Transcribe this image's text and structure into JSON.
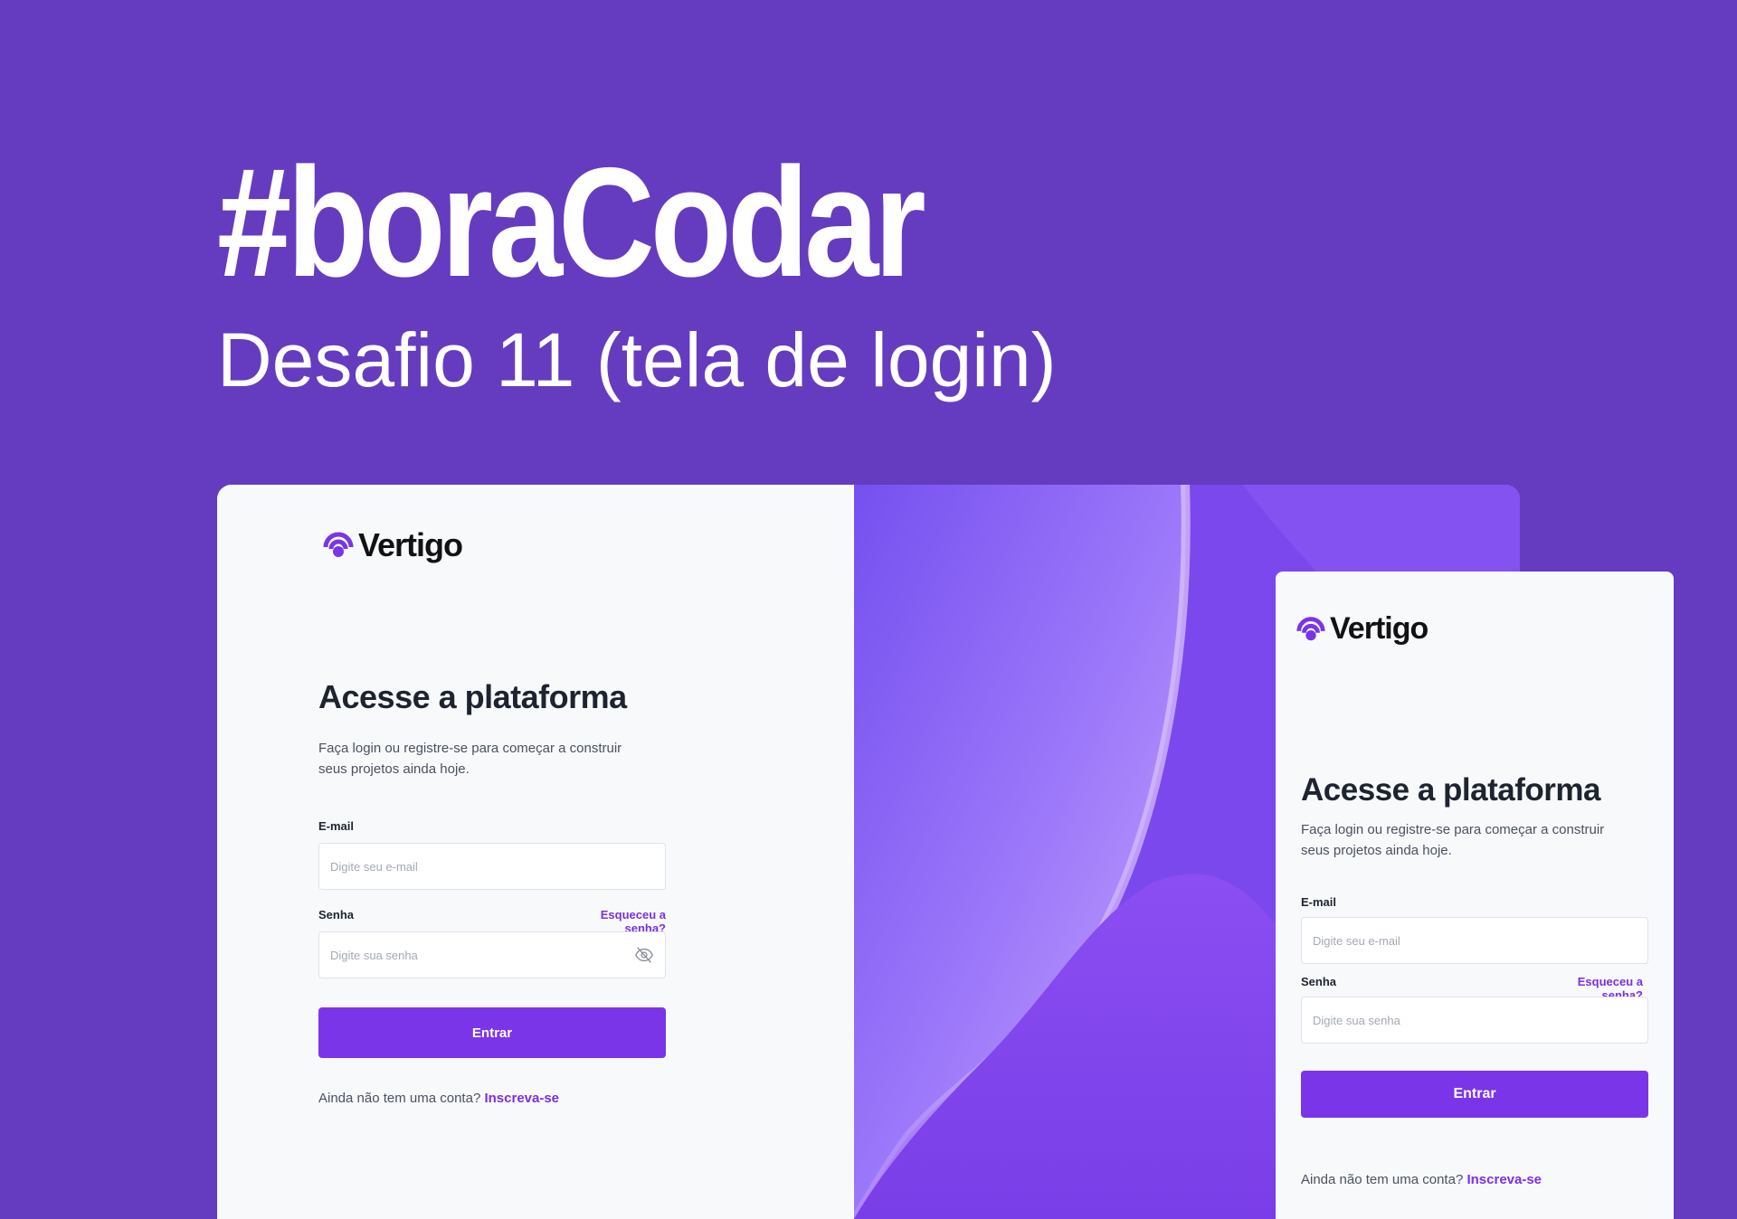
{
  "hero": {
    "title": "#boraCodar",
    "subtitle": "Desafio 11 (tela de login)"
  },
  "brand": {
    "name": "Vertigo",
    "logo_icon": "vertigo-logo-icon",
    "accent": "#7b35e8"
  },
  "form": {
    "title": "Acesse a plataforma",
    "description_line1": "Faça login ou registre-se para começar a construir",
    "description_line2": "seus projetos ainda hoje.",
    "email_label": "E-mail",
    "email_placeholder": "Digite seu e-mail",
    "password_label": "Senha",
    "forgot_label": "Esqueceu a senha?",
    "password_placeholder": "Digite sua senha",
    "password_toggle_icon": "eye-off-icon",
    "submit_label": "Entrar",
    "signup_prefix": "Ainda não tem uma conta?",
    "signup_link": "Inscreva-se"
  },
  "colors": {
    "page_bg": "#653cbf",
    "panel_gradient_start": "#7b4ff0",
    "panel_gradient_end": "#8f4bf0",
    "button": "#7b35e8",
    "link": "#7b2fe8"
  }
}
